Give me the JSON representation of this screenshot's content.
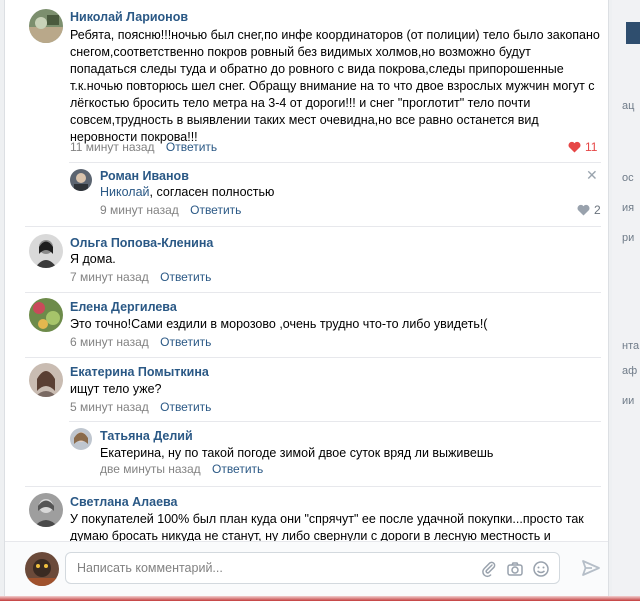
{
  "right_panel": {
    "fragments": [
      "ац",
      "ос",
      "ия",
      "ри",
      "нта",
      "аф",
      "ии"
    ]
  },
  "comments": [
    {
      "author": "Николай Ларионов",
      "text": "Ребята, поясню!!!ночью был снег,по инфе координаторов (от полиции) тело было закопано снегом,соответственно покров ровный без видимых холмов,но возможно будут попадаться следы туда и обратно до ровного с вида покрова,следы припорошенные т.к.ночью повторюсь шел снег. Обращу внимание на то что двое взрослых мужчин могут с лёгкостью бросить тело метра на 3-4 от дороги!!! и снег \"проглотит\" тело почти совсем,трудность в выявлении таких мест очевидна,но все равно останется вид неровности покрова!!!",
      "time": "11 минут назад",
      "reply": "Ответить",
      "likes": "11"
    },
    {
      "author": "Роман Иванов",
      "mention": "Николай",
      "text": ", согласен полностью",
      "time": "9 минут назад",
      "reply": "Ответить",
      "likes": "2"
    },
    {
      "author": "Ольга Попова-Кленина",
      "text": "Я дома.",
      "time": "7 минут назад",
      "reply": "Ответить"
    },
    {
      "author": "Елена Дергилева",
      "text": "Это точно!Сами ездили в морозово ,очень трудно что-то либо увидеть!(",
      "time": "6 минут назад",
      "reply": "Ответить"
    },
    {
      "author": "Екатерина Помыткина",
      "text": "ищут тело уже?",
      "time": "5 минут назад",
      "reply": "Ответить"
    },
    {
      "author": "Татьяна Делий",
      "text": "Екатерина, ну по такой погоде зимой двое суток вряд ли выживешь",
      "time": "две минуты назад",
      "reply": "Ответить"
    },
    {
      "author": "Светлана Алаева",
      "text": "У покупателей 100% был план куда они \"спрячут\" ее после удачной покупки...просто так думаю бросать никуда не станут, ну либо свернули с дороги в лесную местность и"
    }
  ],
  "composer": {
    "placeholder": "Написать комментарий..."
  },
  "colors": {
    "link": "#2a5885",
    "like_active": "#e64646",
    "like_inactive": "#99a2ad",
    "meta": "#828282"
  },
  "icons": [
    "heart-icon",
    "close-icon",
    "paperclip-icon",
    "camera-icon",
    "smile-icon",
    "send-icon"
  ]
}
